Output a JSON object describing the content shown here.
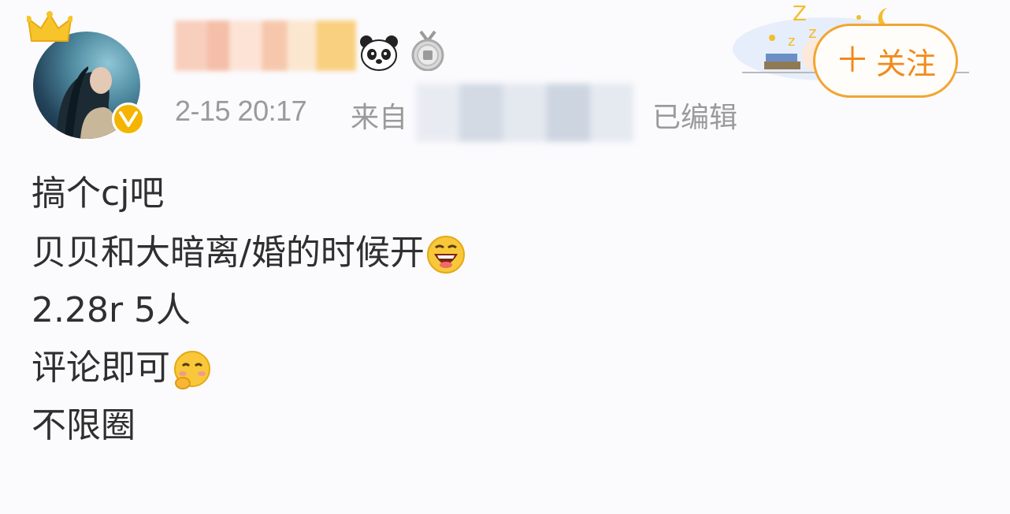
{
  "header": {
    "time": "2-15 20:17",
    "from_label": "来自",
    "edited_label": "已编辑",
    "follow": {
      "plus": "＋",
      "label": "关注"
    }
  },
  "icons": {
    "verified": "verified-badge-icon",
    "crown": "crown-icon",
    "panda": "panda-badge-icon",
    "medal": "medal-badge-icon",
    "laugh": "laughing-emoji-icon",
    "shy": "shy-emoji-icon"
  },
  "colors": {
    "accent": "#f28a1c",
    "verified": "#f5b400",
    "meta_text": "#9a9a9a",
    "body_text": "#2f2f2f"
  },
  "post": {
    "lines": [
      "搞个cj吧",
      "贝贝和大暗离/婚的时候开",
      "2.28r 5人",
      "评论即可",
      "不限圈"
    ]
  }
}
